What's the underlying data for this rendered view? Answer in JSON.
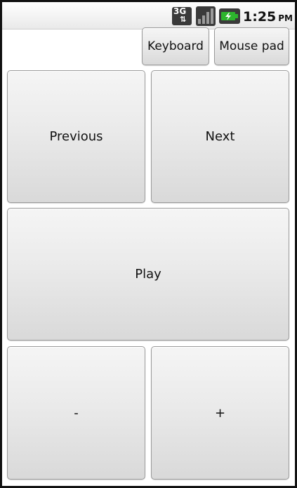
{
  "status_bar": {
    "network_label": "3G",
    "network_icon": "3g-data-icon",
    "signal_icon": "signal-bars-icon",
    "battery_icon": "battery-charging-icon",
    "time": "1:25",
    "ampm": "PM"
  },
  "top_bar": {
    "keyboard_label": "Keyboard",
    "mousepad_label": "Mouse pad"
  },
  "controls": {
    "previous_label": "Previous",
    "next_label": "Next",
    "play_label": "Play",
    "volume_down_label": "-",
    "volume_up_label": "+"
  },
  "colors": {
    "battery_fill": "#2db52d",
    "button_text": "#111111"
  }
}
